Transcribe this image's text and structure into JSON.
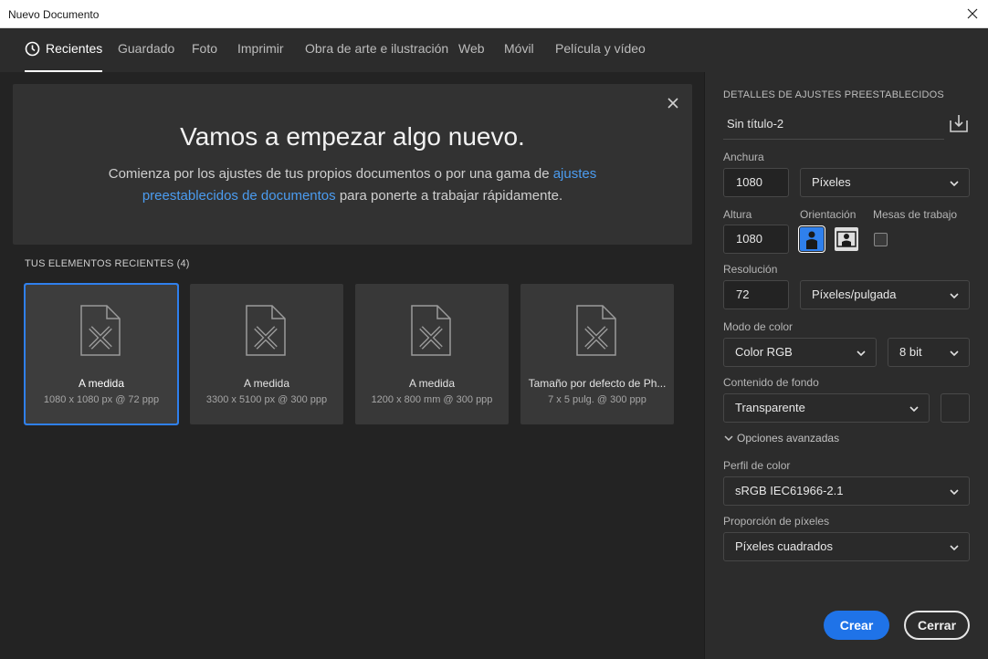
{
  "window": {
    "title": "Nuevo Documento"
  },
  "tabs": [
    {
      "label": "Recientes",
      "active": true
    },
    {
      "label": "Guardado"
    },
    {
      "label": "Foto"
    },
    {
      "label": "Imprimir"
    },
    {
      "label": "Obra de arte e ilustración"
    },
    {
      "label": "Web"
    },
    {
      "label": "Móvil"
    },
    {
      "label": "Película y vídeo"
    }
  ],
  "welcome": {
    "headline": "Vamos a empezar algo nuevo.",
    "desc_line1_pre": "Comienza por los ajustes de tus propios documentos o por una gama de ",
    "desc_link_1": "ajustes",
    "desc_link_2": "preestablecidos de documentos",
    "desc_line2_post": " para ponerte a trabajar rápidamente."
  },
  "recent": {
    "label": "TUS ELEMENTOS RECIENTES",
    "count": "(4)",
    "items": [
      {
        "name": "A medida",
        "meta": "1080 x 1080 px @ 72 ppp",
        "selected": true
      },
      {
        "name": "A medida",
        "meta": "3300 x 5100 px @ 300 ppp"
      },
      {
        "name": "A medida",
        "meta": "1200 x 800 mm @ 300 ppp"
      },
      {
        "name": "Tamaño por defecto de Ph...",
        "meta": "7 x 5 pulg. @ 300 ppp"
      }
    ]
  },
  "preset": {
    "section_title": "DETALLES DE AJUSTES PREESTABLECIDOS",
    "name": "Sin título-2",
    "width_label": "Anchura",
    "width": "1080",
    "width_unit": "Píxeles",
    "height_label": "Altura",
    "height": "1080",
    "orientation_label": "Orientación",
    "orientation": "portrait",
    "artboards_label": "Mesas de trabajo",
    "artboards_checked": false,
    "resolution_label": "Resolución",
    "resolution": "72",
    "resolution_unit": "Píxeles/pulgada",
    "color_mode_label": "Modo de color",
    "color_mode": "Color RGB",
    "bit_depth": "8 bit",
    "background_label": "Contenido de fondo",
    "background": "Transparente",
    "advanced_label": "Opciones avanzadas",
    "color_profile_label": "Perfil de color",
    "color_profile": "sRGB IEC61966-2.1",
    "pixel_aspect_label": "Proporción de píxeles",
    "pixel_aspect": "Píxeles cuadrados"
  },
  "actions": {
    "create": "Crear",
    "cancel": "Cerrar"
  },
  "colors": {
    "accent": "#1f73e8",
    "link": "#4b9cf0",
    "panel": "#2c2c2c",
    "background": "#232323"
  }
}
